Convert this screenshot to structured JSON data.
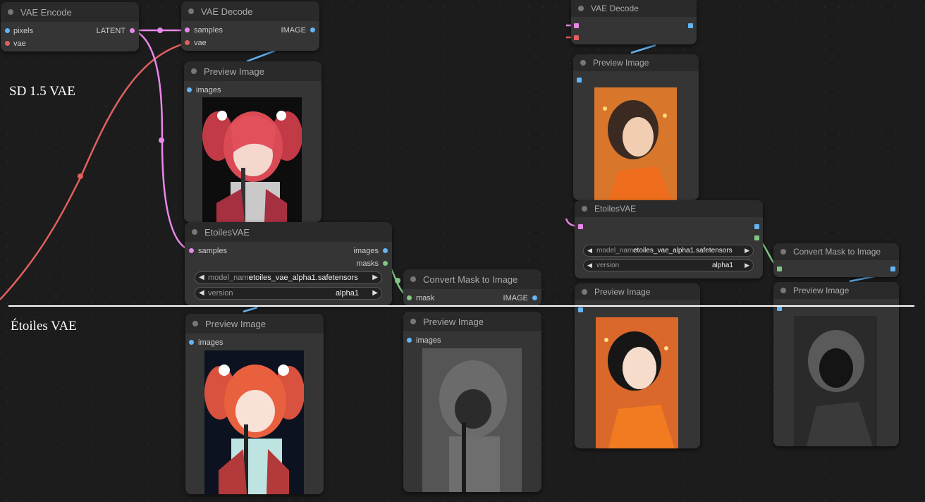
{
  "colors": {
    "latent": "#e888e8",
    "vae": "#e06060",
    "image": "#64b5f6",
    "mask": "#81c784",
    "model": "#b39ddb"
  },
  "labels": {
    "sd15": "SD 1.5 VAE",
    "etoiles": "Étoiles VAE"
  },
  "vae_encode": {
    "title": "VAE Encode",
    "in_pixels": "pixels",
    "in_vae": "vae",
    "out_latent": "LATENT"
  },
  "vae_decode_a": {
    "title": "VAE Decode",
    "in_samples": "samples",
    "in_vae": "vae",
    "out_image": "IMAGE"
  },
  "preview_a": {
    "title": "Preview Image",
    "in_images": "images"
  },
  "etoiles_a": {
    "title": "EtoilesVAE",
    "in_samples": "samples",
    "out_images": "images",
    "out_masks": "masks",
    "w_model_name": "model_name",
    "w_model_value": "etoiles_vae_alpha1.safetensors",
    "w_version_name": "version",
    "w_version_value": "alpha1"
  },
  "convert_a": {
    "title": "Convert Mask to Image",
    "in_mask": "mask",
    "out_image": "IMAGE"
  },
  "preview_b": {
    "title": "Preview Image",
    "in_images": "images"
  },
  "preview_c": {
    "title": "Preview Image",
    "in_images": "images"
  },
  "vae_decode_b": {
    "title": "VAE Decode"
  },
  "preview_d": {
    "title": "Preview Image"
  },
  "etoiles_b": {
    "title": "EtoilesVAE",
    "w_model_name": "model_name",
    "w_model_value": "etoiles_vae_alpha1.safetensors",
    "w_version_name": "version",
    "w_version_value": "alpha1"
  },
  "convert_b": {
    "title": "Convert Mask to Image"
  },
  "preview_e": {
    "title": "Preview Image"
  },
  "preview_f": {
    "title": "Preview Image"
  }
}
